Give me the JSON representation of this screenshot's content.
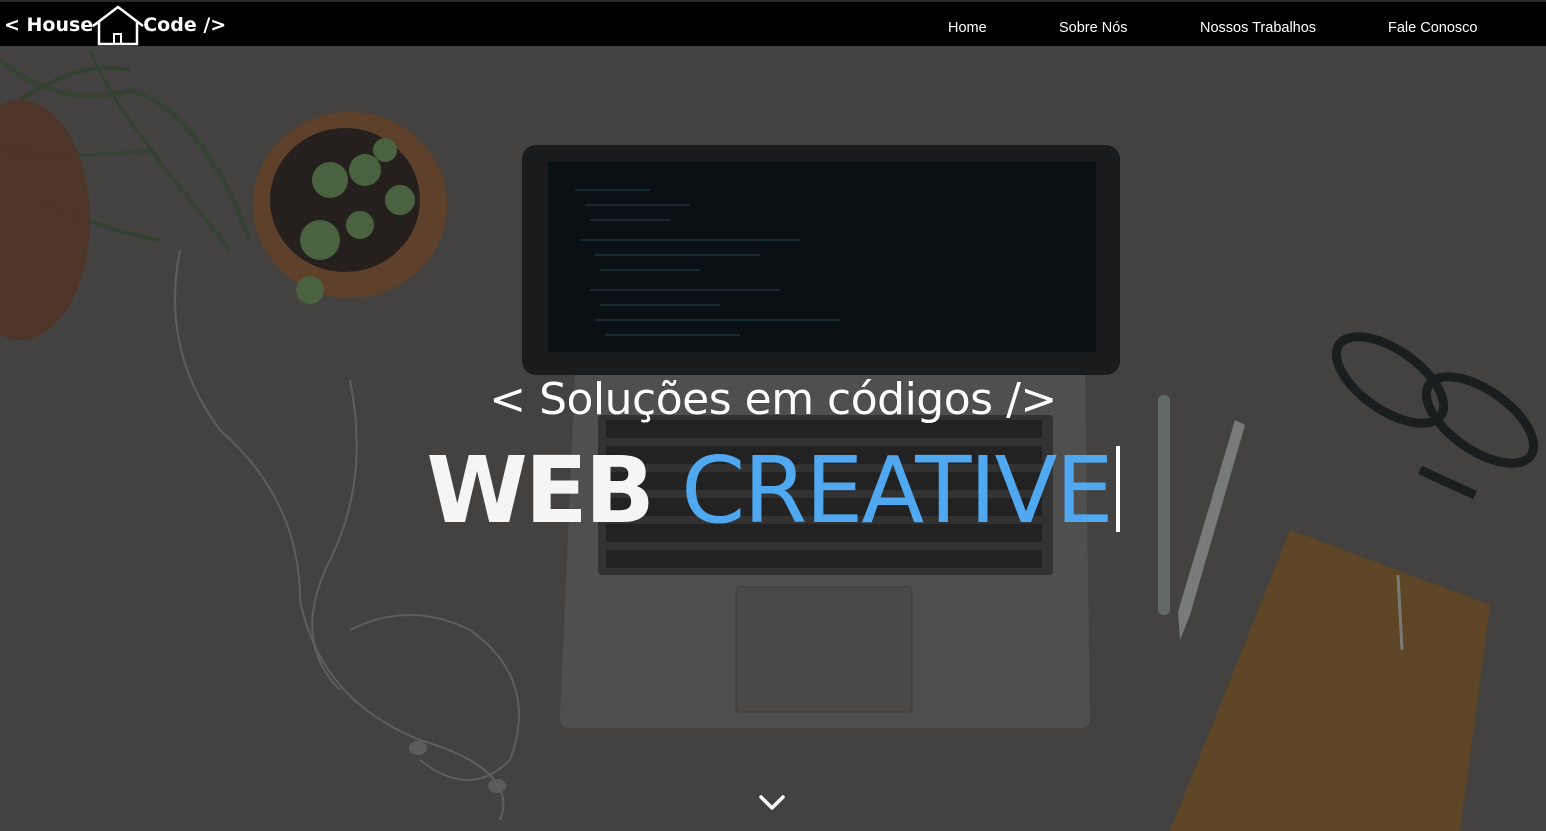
{
  "navbar": {
    "logo": {
      "left": "< House",
      "right": "Code />",
      "icon": "house-icon"
    },
    "links": [
      {
        "label": "Home"
      },
      {
        "label": "Sobre Nós"
      },
      {
        "label": "Nossos Trabalhos"
      },
      {
        "label": "Fale Conosco"
      }
    ]
  },
  "hero": {
    "slogan": "< Soluções em códigos />",
    "headline": {
      "word1": "WEB",
      "word2": "CREATIVE"
    },
    "scroll_icon": "chevron-down-icon"
  },
  "colors": {
    "navbar": "#000000",
    "accent": "#4fa8f0",
    "text": "#ffffff"
  }
}
